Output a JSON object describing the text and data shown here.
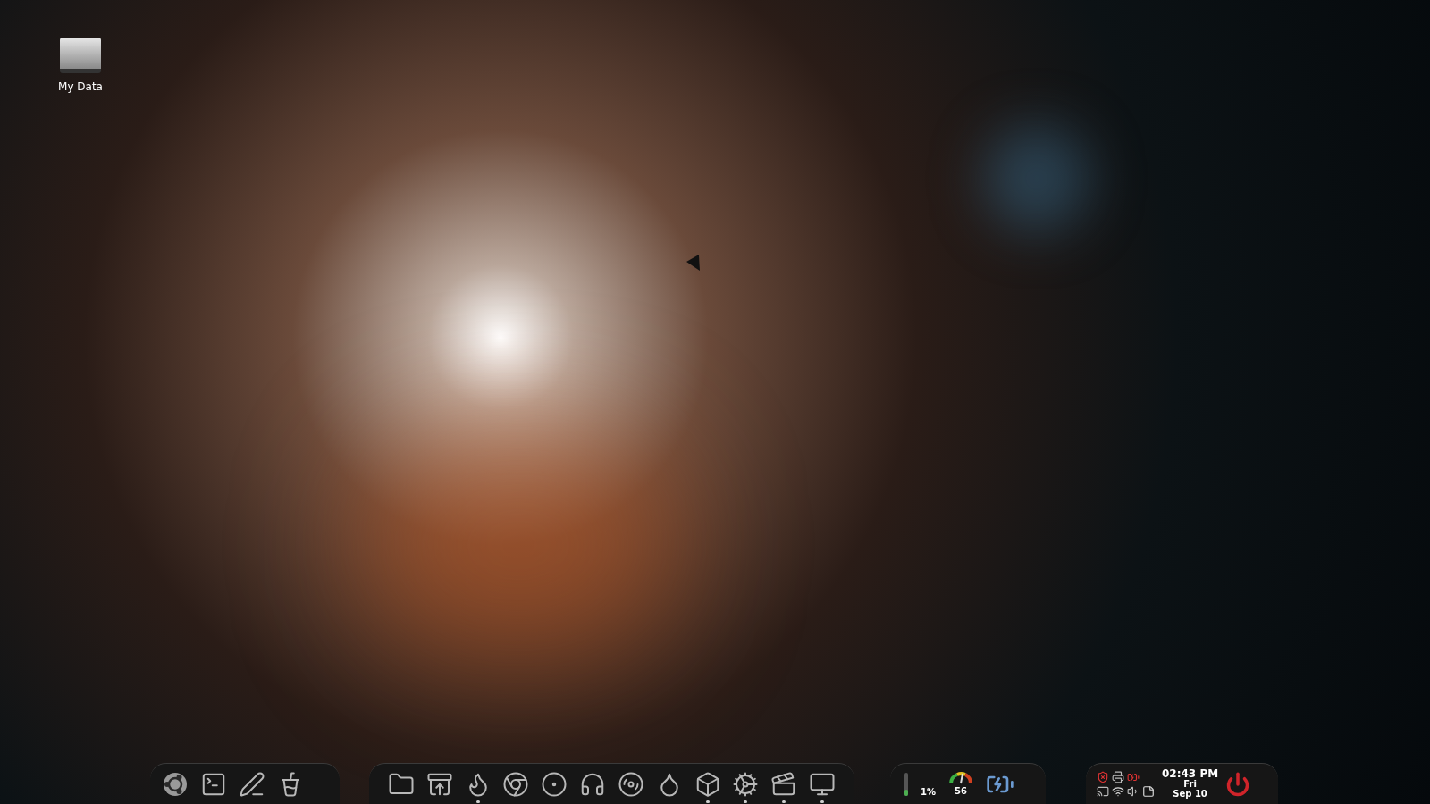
{
  "desktop_icons": [
    {
      "label": "My Data"
    }
  ],
  "dock": {
    "left_launchers": [
      {
        "kind": "ubuntu",
        "running": false
      },
      {
        "kind": "terminal",
        "running": false
      },
      {
        "kind": "editor",
        "running": false
      },
      {
        "kind": "trash",
        "running": false
      }
    ],
    "launchers": [
      {
        "kind": "folder",
        "running": false
      },
      {
        "kind": "download",
        "running": false
      },
      {
        "kind": "firefox",
        "running": true
      },
      {
        "kind": "chrome",
        "running": false
      },
      {
        "kind": "opera",
        "running": false
      },
      {
        "kind": "headphones",
        "running": false
      },
      {
        "kind": "music",
        "running": false
      },
      {
        "kind": "drop",
        "running": false
      },
      {
        "kind": "cube",
        "running": true
      },
      {
        "kind": "gear",
        "running": true
      },
      {
        "kind": "video",
        "running": true
      },
      {
        "kind": "screen",
        "running": true
      }
    ],
    "monitors": {
      "meter": {
        "level": 0.25
      },
      "cpu_reading": "1%",
      "gauge_reading": "56"
    },
    "clock": {
      "time": "02:43 PM",
      "day": "Fri",
      "date": "Sep 10"
    }
  }
}
